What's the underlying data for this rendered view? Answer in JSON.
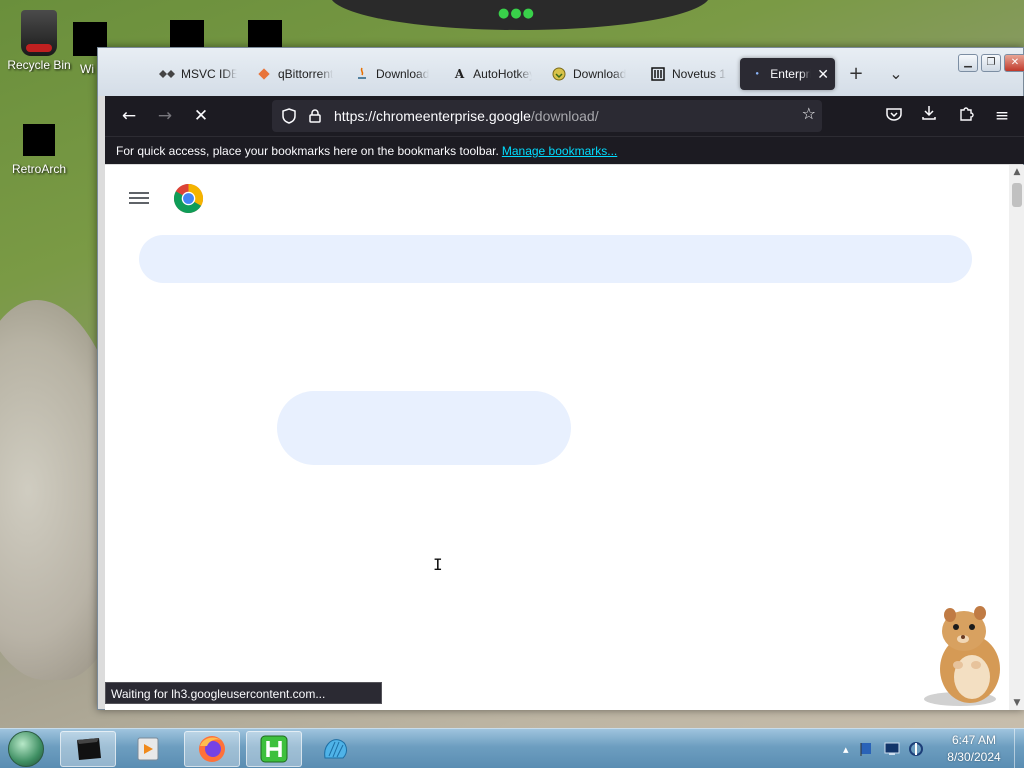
{
  "desktop": {
    "icons": [
      {
        "label": "Recycle Bin"
      },
      {
        "label": "Wi"
      },
      {
        "label": "RetroArch"
      }
    ]
  },
  "browser": {
    "tabs": [
      {
        "label": "MSVC IDE",
        "icon": "msvc-icon"
      },
      {
        "label": "qBittorrent",
        "icon": "qbittorrent-icon"
      },
      {
        "label": "Download",
        "icon": "java-download-icon"
      },
      {
        "label": "AutoHotkey",
        "icon": "autohotkey-icon"
      },
      {
        "label": "Download",
        "icon": "download-icon"
      },
      {
        "label": "Novetus 1",
        "icon": "novetus-icon"
      },
      {
        "label": "Enterprise",
        "icon": "loading-dot-icon",
        "active": true
      }
    ],
    "new_tab": "+",
    "tab_list": "⌄",
    "url": {
      "host": "https://chromeenterprise.google",
      "path": "/download/"
    },
    "bookmarks_bar": {
      "text": "For quick access, place your bookmarks here on the bookmarks toolbar.",
      "link": "Manage bookmarks..."
    },
    "status_text": "Waiting for lh3.googleusercontent.com..."
  },
  "taskbar": {
    "clock": {
      "time": "6:47 AM",
      "date": "8/30/2024"
    },
    "tray_arrow": "▴"
  },
  "colors": {
    "browser_toolbar": "#1c1b22",
    "url_field": "#2b2a33",
    "link": "#00ddff",
    "skeleton": "#e8f0fe"
  }
}
